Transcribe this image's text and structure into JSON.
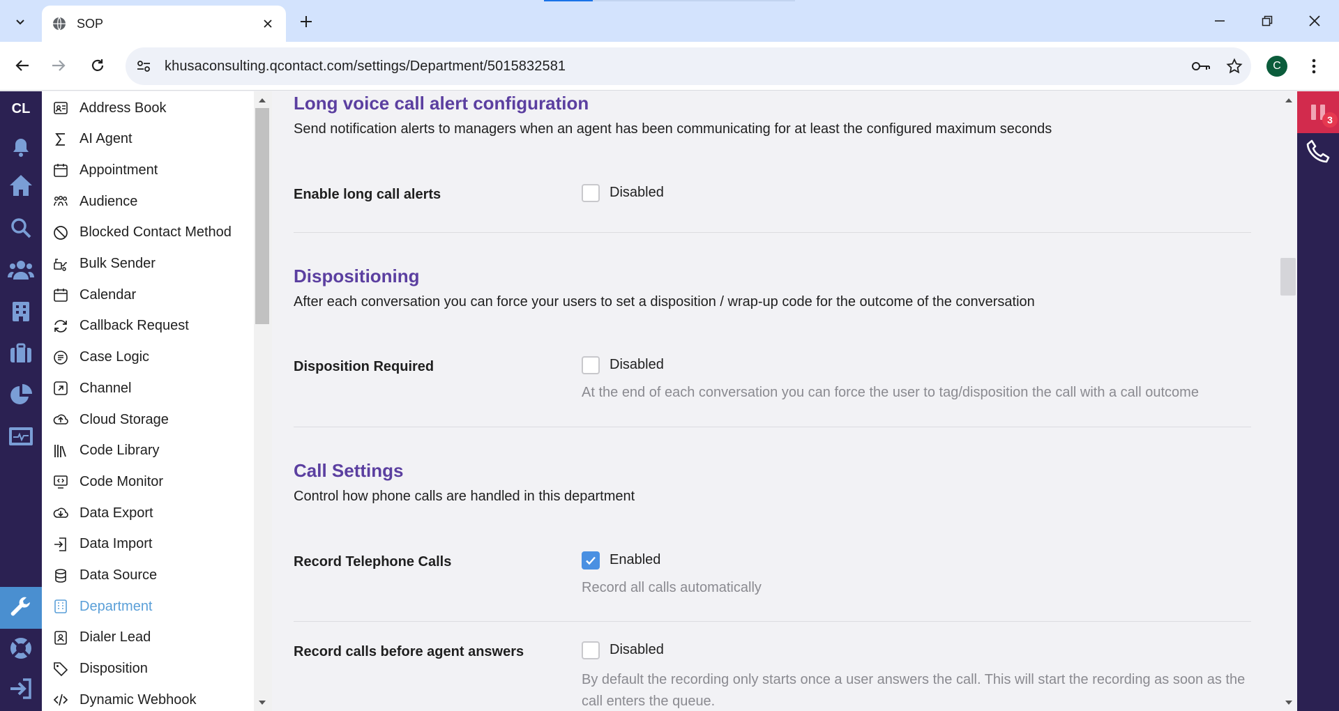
{
  "browser": {
    "tab_title": "SOP",
    "url": "khusaconsulting.qcontact.com/settings/Department/5015832581",
    "profile_initial": "C"
  },
  "rail": {
    "logo": "CL",
    "icons": [
      "bell-icon",
      "home-icon",
      "search-icon",
      "users-icon",
      "building-icon",
      "briefcase-icon",
      "pie-chart-icon",
      "monitor-icon",
      "wrench-icon",
      "lifebuoy-icon",
      "logout-icon"
    ]
  },
  "menu": {
    "items": [
      {
        "label": "Address Book",
        "icon": "address-book-icon"
      },
      {
        "label": "AI Agent",
        "icon": "sigma-icon"
      },
      {
        "label": "Appointment",
        "icon": "calendar-icon"
      },
      {
        "label": "Audience",
        "icon": "audience-icon"
      },
      {
        "label": "Blocked Contact Method",
        "icon": "blocked-icon"
      },
      {
        "label": "Bulk Sender",
        "icon": "bulk-sender-icon"
      },
      {
        "label": "Calendar",
        "icon": "calendar-icon"
      },
      {
        "label": "Callback Request",
        "icon": "refresh-icon"
      },
      {
        "label": "Case Logic",
        "icon": "case-logic-icon"
      },
      {
        "label": "Channel",
        "icon": "channel-icon"
      },
      {
        "label": "Cloud Storage",
        "icon": "cloud-upload-icon"
      },
      {
        "label": "Code Library",
        "icon": "library-icon"
      },
      {
        "label": "Code Monitor",
        "icon": "code-monitor-icon"
      },
      {
        "label": "Data Export",
        "icon": "cloud-download-icon"
      },
      {
        "label": "Data Import",
        "icon": "import-icon"
      },
      {
        "label": "Data Source",
        "icon": "database-icon"
      },
      {
        "label": "Department",
        "icon": "department-icon",
        "active": true
      },
      {
        "label": "Dialer Lead",
        "icon": "contact-card-icon"
      },
      {
        "label": "Disposition",
        "icon": "tag-icon"
      },
      {
        "label": "Dynamic Webhook",
        "icon": "code-icon"
      }
    ]
  },
  "sections": {
    "long_call": {
      "title": "Long voice call alert configuration",
      "desc": "Send notification alerts to managers when an agent has been communicating for at least the configured maximum seconds",
      "enable_label": "Enable long call alerts",
      "enable_state": "Disabled",
      "enable_checked": false
    },
    "dispositioning": {
      "title": "Dispositioning",
      "desc": "After each conversation you can force your users to set a disposition / wrap-up code for the outcome of the conversation",
      "required_label": "Disposition Required",
      "required_state": "Disabled",
      "required_checked": false,
      "required_help": "At the end of each conversation you can force the user to tag/disposition the call with a call outcome"
    },
    "call_settings": {
      "title": "Call Settings",
      "desc": "Control how phone calls are handled in this department",
      "record_label": "Record Telephone Calls",
      "record_state": "Enabled",
      "record_checked": true,
      "record_help": "Record all calls automatically",
      "before_answer_label": "Record calls before agent answers",
      "before_answer_state": "Disabled",
      "before_answer_checked": false,
      "before_answer_help": "By default the recording only starts once a user answers the call. This will start the recording as soon as the call enters the queue."
    }
  },
  "softphone": {
    "badge_count": "3"
  },
  "colors": {
    "rail_bg": "#2b2152",
    "section_title": "#5b3fa0",
    "active_menu": "#5a9fd8",
    "checkbox_checked": "#4a90e2",
    "softphone_alert": "#d22b4d"
  }
}
